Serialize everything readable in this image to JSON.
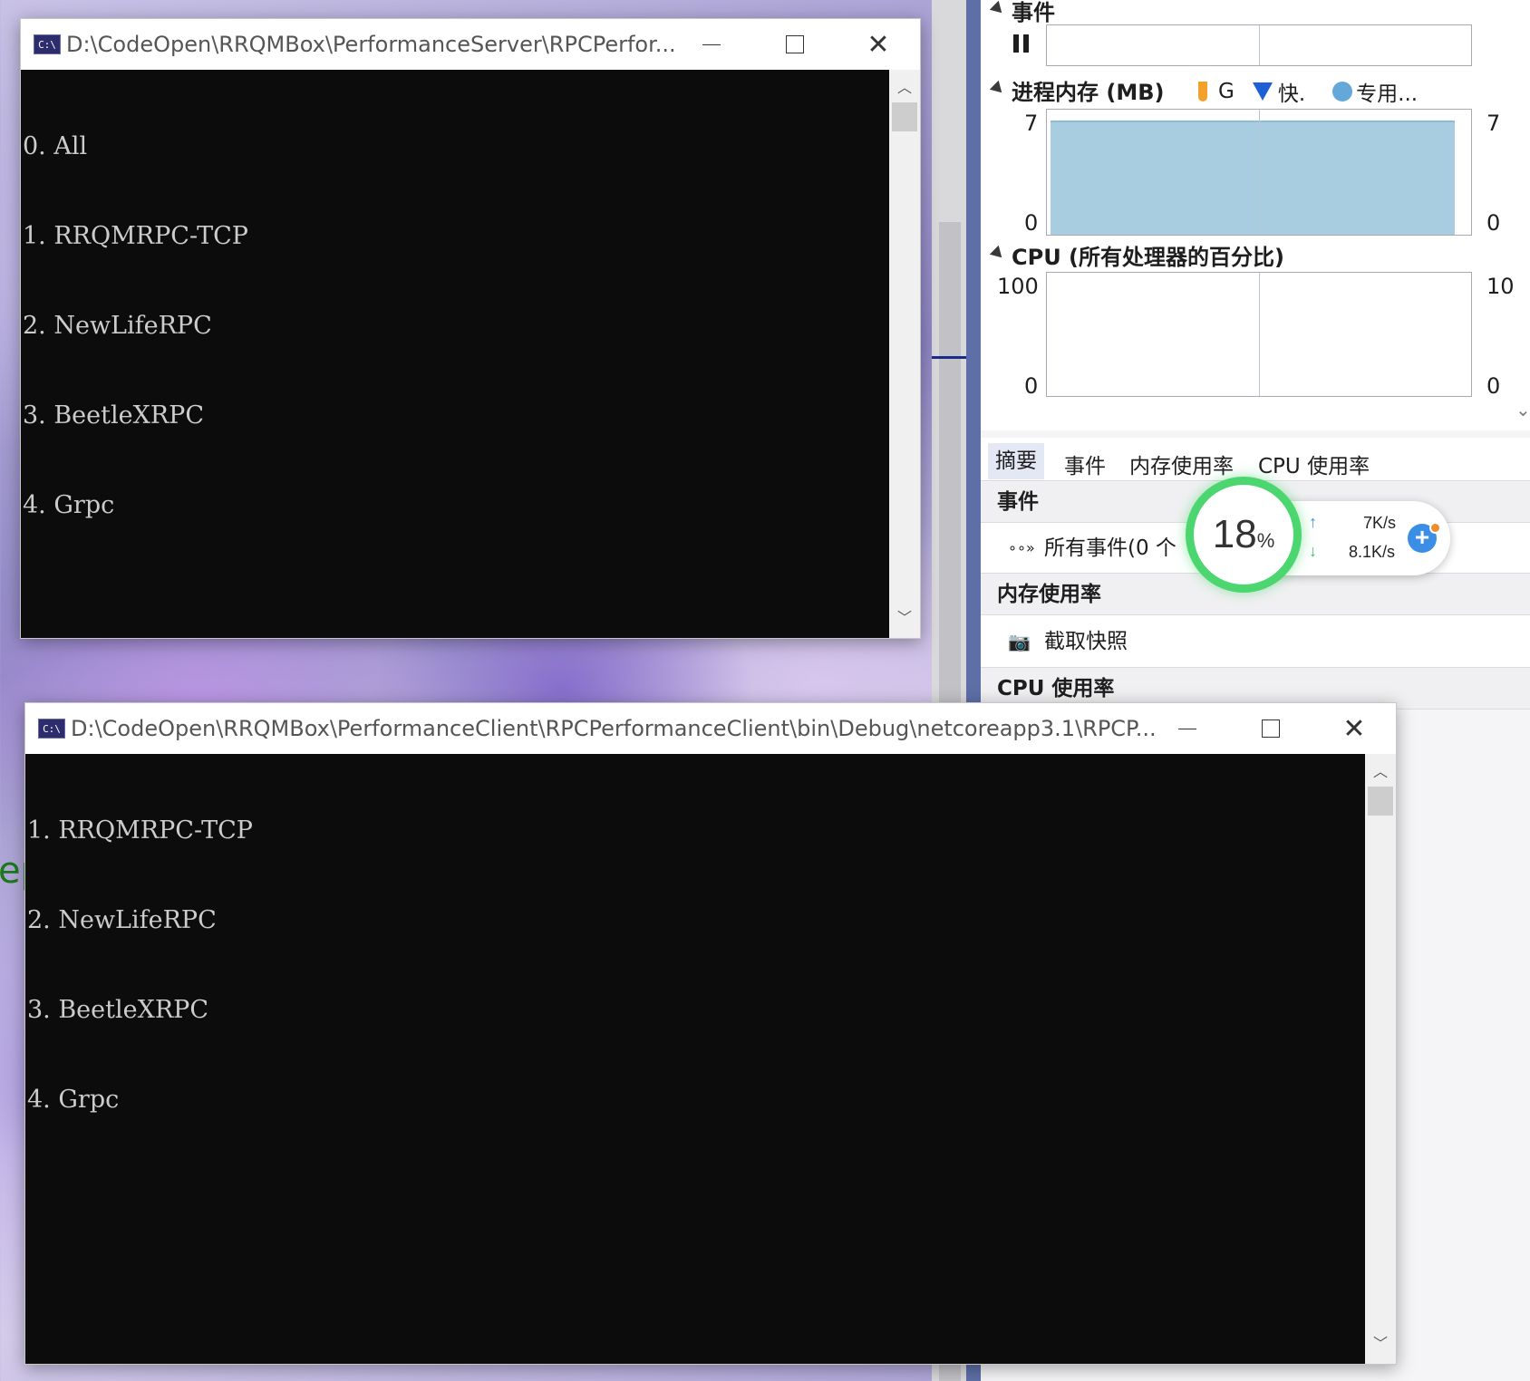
{
  "server_window": {
    "title": "D:\\CodeOpen\\RRQMBox\\PerformanceServer\\RPCPerfor...",
    "icon_text": "C:\\",
    "lines": [
      "0. All",
      "1. RRQMRPC-TCP",
      "2. NewLifeRPC",
      "3. BeetleXRPC",
      "4. Grpc"
    ]
  },
  "client_window": {
    "title": "D:\\CodeOpen\\RRQMBox\\PerformanceClient\\RPCPerformanceClient\\bin\\Debug\\netcoreapp3.1\\RPCP...",
    "icon_text": "C:\\",
    "lines": [
      "1. RRQMRPC-TCP",
      "2. NewLifeRPC",
      "3. BeetleXRPC",
      "4. Grpc"
    ]
  },
  "window_buttons": {
    "close_glyph": "✕"
  },
  "diag": {
    "events_header": "事件",
    "memory_header": "进程内存 (MB)",
    "memory_legend": {
      "gc": "G",
      "snapshot": "快.",
      "private": "专用..."
    },
    "memory_axis": {
      "left_top": "7",
      "left_bottom": "0",
      "right_top": "7",
      "right_bottom": "0"
    },
    "cpu_header": "CPU (所有处理器的百分比)",
    "cpu_axis": {
      "left_top": "100",
      "left_bottom": "0",
      "right_top": "10",
      "right_bottom": "0"
    },
    "tabs": [
      "摘要",
      "事件",
      "内存使用率",
      "CPU 使用率"
    ],
    "summary": {
      "events_section": "事件",
      "all_events": "所有事件(0 个",
      "memory_section": "内存使用率",
      "snapshot_action": "截取快照",
      "cpu_section": "CPU 使用率"
    }
  },
  "net_widget": {
    "percent": "18",
    "percent_unit": "%",
    "upload": "7K/s",
    "download": "8.1K/s",
    "ring_color": "#4bd66f"
  },
  "background_fragment": "ep"
}
